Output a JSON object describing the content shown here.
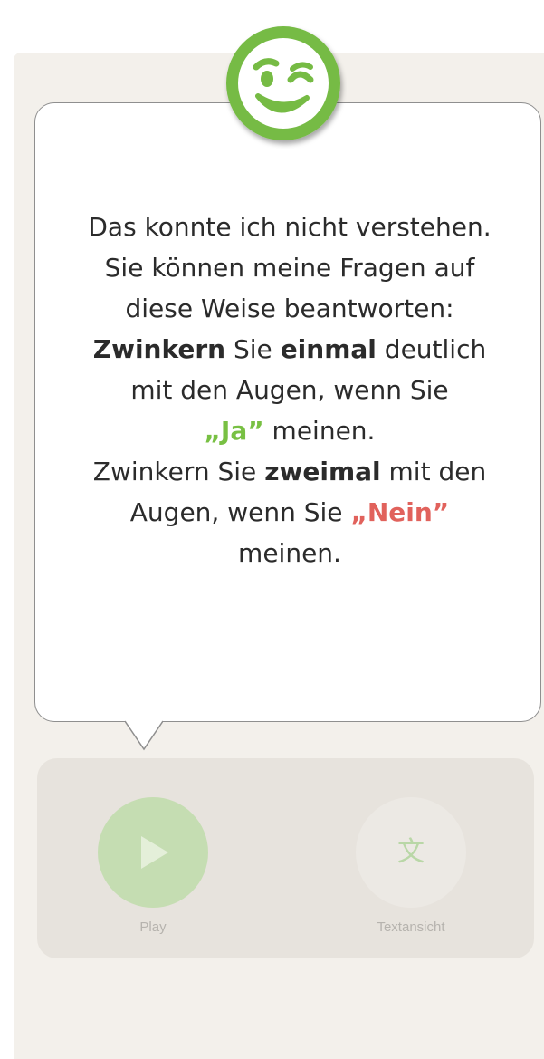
{
  "message": {
    "line1": "Das konnte ich nicht verstehen.",
    "line2": "Sie können meine Fragen auf",
    "line3": "diese Weise beantworten:",
    "line4_bold1": "Zwinkern",
    "line4_text1": " Sie ",
    "line4_bold2": "einmal",
    "line4_text2": " deutlich",
    "line5": "mit den Augen, wenn Sie",
    "line6_yes": "„Ja”",
    "line6_text": " meinen.",
    "line7_text1": "Zwinkern Sie ",
    "line7_bold": "zweimal",
    "line7_text2": " mit den",
    "line8_text": "Augen, wenn Sie ",
    "line8_no": "„Nein”",
    "line9": "meinen."
  },
  "controls": {
    "play_label": "Play",
    "text_view_label": "Textansicht",
    "play_icon": "play-icon",
    "translate_icon": "translate-icon",
    "translate_glyph": "文"
  },
  "avatar": {
    "icon": "winking-face-icon",
    "accent_color": "#76bb44"
  },
  "colors": {
    "yes": "#78c043",
    "no": "#e1625c",
    "panel_background": "#f3f0eb",
    "controls_background": "#e7e3dd"
  }
}
